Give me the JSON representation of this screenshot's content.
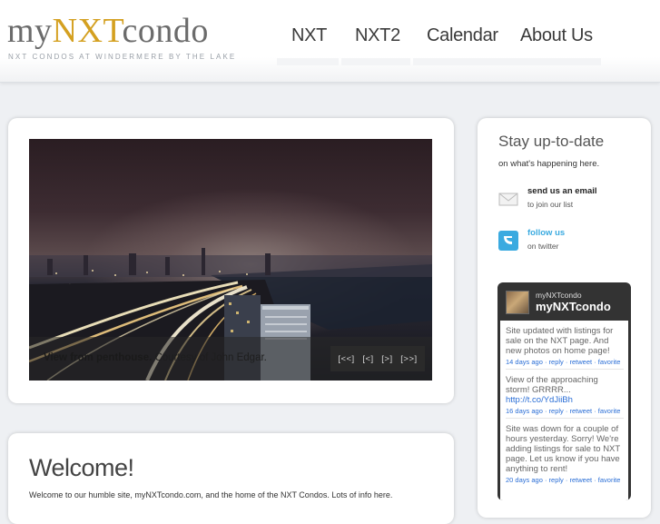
{
  "site": {
    "logo_part1": "my",
    "logo_part2": "NXT",
    "logo_part3": "condo",
    "tagline": "NXT CONDOS AT WINDERMERE BY THE LAKE"
  },
  "nav": [
    {
      "label": "NXT"
    },
    {
      "label": "NXT2"
    },
    {
      "label": "Calendar"
    },
    {
      "label": "About Us"
    }
  ],
  "slideshow": {
    "caption_bold": "View from penthouse.",
    "caption_rest": " Courtesy of John Edgar.",
    "controls": {
      "first": "[<<]",
      "prev": "[<]",
      "next": "[>]",
      "last": "[>>]"
    }
  },
  "main": {
    "welcome_title": "Welcome!",
    "intro_text": "Welcome to our humble site, myNXTcondo.com, and the home of the NXT Condos. Lots of info here."
  },
  "sidebar": {
    "title": "Stay up-to-date",
    "subtitle": "on what's happening here.",
    "email": {
      "title": "send us an email",
      "sub": "to join our list",
      "icon": "envelope-icon"
    },
    "twitter": {
      "title": "follow us",
      "sub": "on twitter",
      "icon": "twitter-icon",
      "color": "#3aaae0"
    }
  },
  "twitter_widget": {
    "handle": "myNXTcondo",
    "name": "myNXTcondo",
    "tweets": [
      {
        "text": "Site updated with listings for sale on the NXT page. And new photos on home page!",
        "link": "",
        "time": "14 days ago",
        "actions": [
          "reply",
          "retweet",
          "favorite"
        ]
      },
      {
        "text": "View of the approaching storm! GRRRR...",
        "link": "http://t.co/YdJiiBh",
        "time": "16 days ago",
        "actions": [
          "reply",
          "retweet",
          "favorite"
        ]
      },
      {
        "text": "Site was down for a couple of hours yesterday. Sorry! We're adding listings for sale to NXT page. Let us know if you have anything to rent!",
        "link": "",
        "time": "20 days ago",
        "actions": [
          "reply",
          "retweet",
          "favorite"
        ]
      }
    ]
  },
  "colors": {
    "accent_gold": "#d4a020",
    "link_blue": "#2a6ed6",
    "widget_dark": "#333333"
  }
}
